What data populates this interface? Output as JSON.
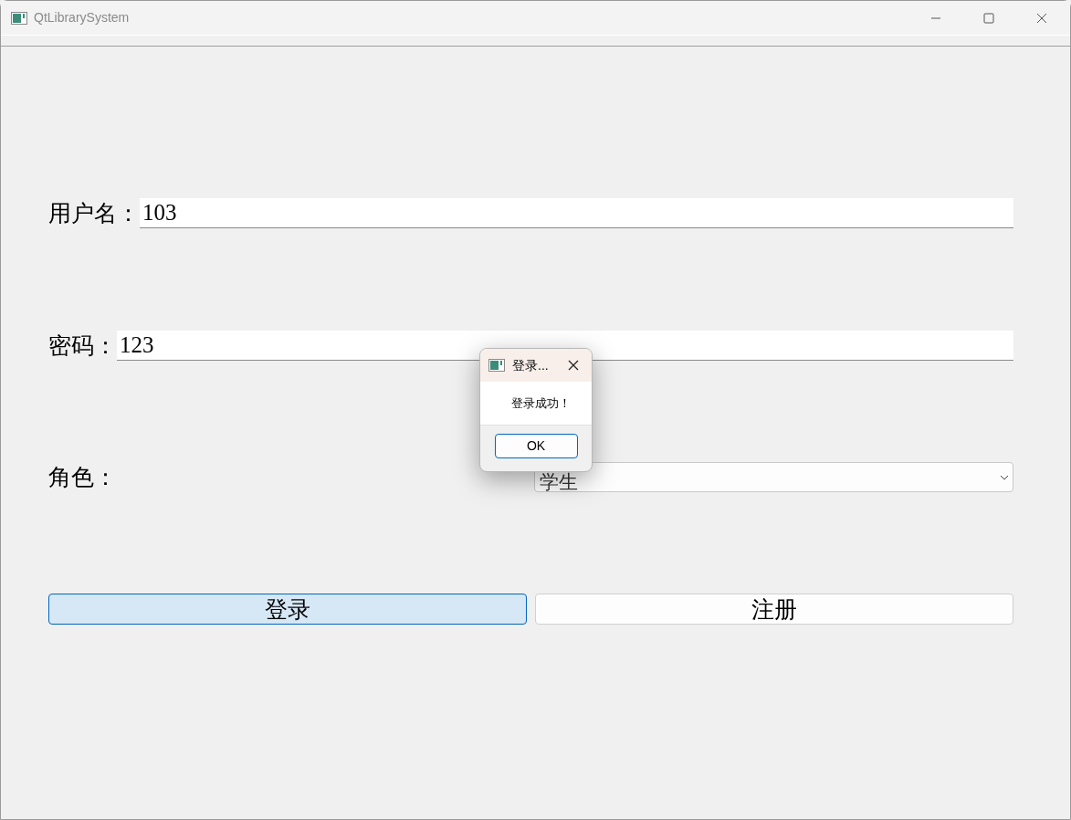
{
  "window": {
    "title": "QtLibrarySystem"
  },
  "form": {
    "fields": [
      {
        "label": "用户名：",
        "value": "103"
      },
      {
        "label": "密码：",
        "value": "123"
      }
    ],
    "role": {
      "label": "角色：",
      "value": "学生"
    }
  },
  "buttons": [
    {
      "label": "登录",
      "focused": true
    },
    {
      "label": "注册",
      "focused": false
    }
  ],
  "dialog": {
    "title": "登录...",
    "message": "登录成功！",
    "button": "OK"
  }
}
